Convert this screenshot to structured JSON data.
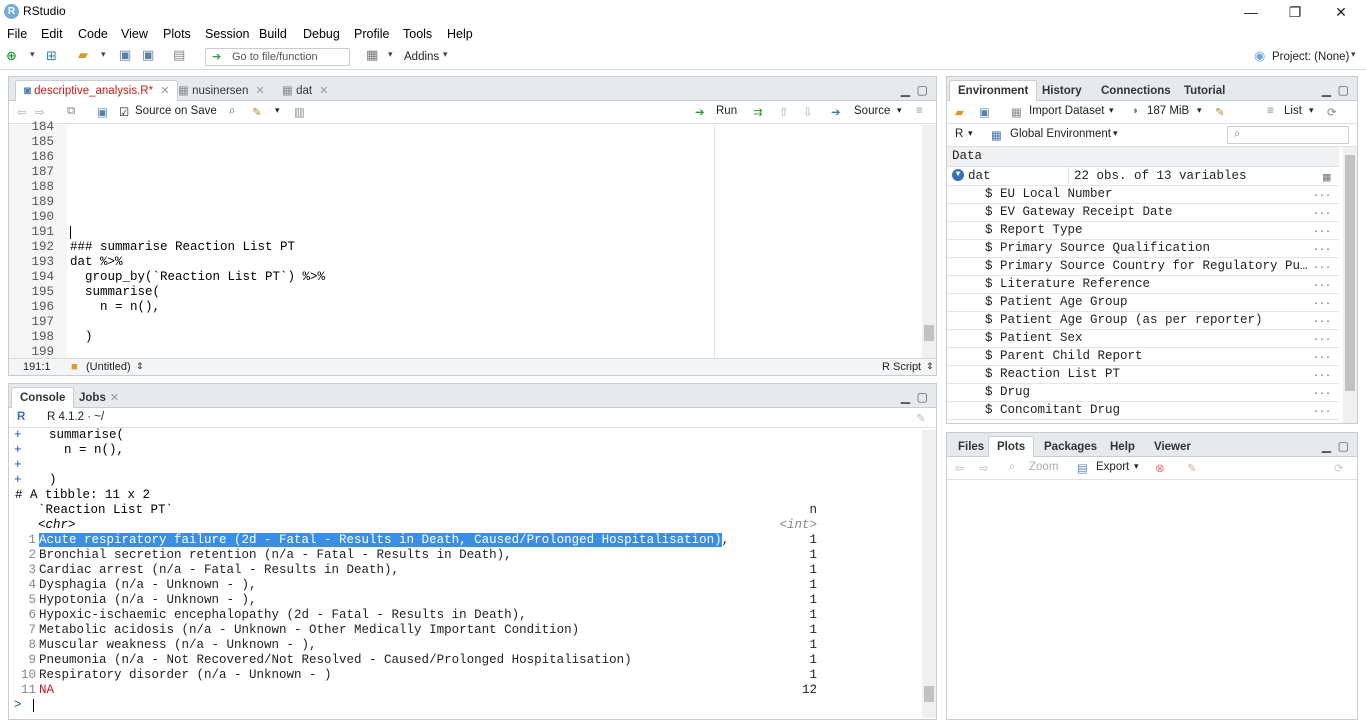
{
  "window": {
    "title": "RStudio",
    "logo_letter": "R",
    "minimize": "—",
    "restore": "❐",
    "close": "✕"
  },
  "menu": [
    "File",
    "Edit",
    "Code",
    "View",
    "Plots",
    "Session",
    "Build",
    "Debug",
    "Profile",
    "Tools",
    "Help"
  ],
  "toolbar": {
    "goto_placeholder": "Go to file/function",
    "addins": "Addins",
    "project": "Project: (None)"
  },
  "editor": {
    "tabs": [
      {
        "label": "descriptive_analysis.R*",
        "active": true
      },
      {
        "label": "nusinersen",
        "active": false
      },
      {
        "label": "dat",
        "active": false
      }
    ],
    "source_on_save": "Source on Save",
    "run": "Run",
    "source": "Source",
    "lines": [
      {
        "n": "184",
        "t": ""
      },
      {
        "n": "185",
        "t": ""
      },
      {
        "n": "186",
        "t": ""
      },
      {
        "n": "187",
        "t": ""
      },
      {
        "n": "188",
        "t": ""
      },
      {
        "n": "189",
        "t": ""
      },
      {
        "n": "190",
        "t": ""
      },
      {
        "n": "191",
        "t": ""
      },
      {
        "n": "192",
        "t": "### summarise Reaction List PT"
      },
      {
        "n": "193",
        "t": "dat %>%"
      },
      {
        "n": "194",
        "t": "  group_by(`Reaction List PT`) %>%"
      },
      {
        "n": "195",
        "t": "  summarise("
      },
      {
        "n": "196",
        "t": "    n = n(),"
      },
      {
        "n": "197",
        "t": ""
      },
      {
        "n": "198",
        "t": "  )"
      },
      {
        "n": "199",
        "t": ""
      }
    ],
    "status_pos": "191:1",
    "status_scope": "(Untitled)",
    "status_type": "R Script"
  },
  "console": {
    "tabs": [
      {
        "label": "Console",
        "active": true
      },
      {
        "label": "Jobs",
        "active": false
      }
    ],
    "r_version": "R 4.1.2 · ~/",
    "cont_lines": [
      {
        "p": "+",
        "t": "  summarise("
      },
      {
        "p": "+",
        "t": "    n = n(),"
      },
      {
        "p": "+",
        "t": ""
      },
      {
        "p": "+",
        "t": "  )"
      }
    ],
    "tibble_header": "# A tibble: 11 x 2",
    "col1": "  `Reaction List PT`",
    "col2": "n",
    "type1": "  <chr>",
    "type2": "<int>",
    "rows": [
      {
        "i": "1",
        "v": "Acute respiratory failure (2d - Fatal - Results in Death, Caused/Prolonged Hospitalisation)",
        "suffix": ",",
        "n": "1"
      },
      {
        "i": "2",
        "v": "Bronchial secretion retention (n/a - Fatal - Results in Death),",
        "suffix": "",
        "n": "1"
      },
      {
        "i": "3",
        "v": "Cardiac arrest (n/a - Fatal - Results in Death),",
        "suffix": "",
        "n": "1"
      },
      {
        "i": "4",
        "v": "Dysphagia (n/a - Unknown - ),",
        "suffix": "",
        "n": "1"
      },
      {
        "i": "5",
        "v": "Hypotonia (n/a - Unknown - ),",
        "suffix": "",
        "n": "1"
      },
      {
        "i": "6",
        "v": "Hypoxic-ischaemic encephalopathy (2d - Fatal - Results in Death),",
        "suffix": "",
        "n": "1"
      },
      {
        "i": "7",
        "v": "Metabolic acidosis (n/a - Unknown - Other Medically Important Condition)",
        "suffix": "",
        "n": "1"
      },
      {
        "i": "8",
        "v": "Muscular weakness (n/a - Unknown - ),",
        "suffix": "",
        "n": "1"
      },
      {
        "i": "9",
        "v": "Pneumonia (n/a - Not Recovered/Not Resolved - Caused/Prolonged Hospitalisation)",
        "suffix": "",
        "n": "1"
      },
      {
        "i": "10",
        "v": "Respiratory disorder (n/a - Unknown - )",
        "suffix": "",
        "n": "1"
      },
      {
        "i": "11",
        "v": "NA",
        "suffix": "",
        "n": "12"
      }
    ],
    "prompt": ">"
  },
  "environment": {
    "tabs": [
      {
        "label": "Environment",
        "active": true
      },
      {
        "label": "History",
        "active": false
      },
      {
        "label": "Connections",
        "active": false
      },
      {
        "label": "Tutorial",
        "active": false
      }
    ],
    "import_dataset": "Import Dataset",
    "memory": "187 MiB",
    "view_mode": "List",
    "lang": "R",
    "scope": "Global Environment",
    "section": "Data",
    "obj_name": "dat",
    "obj_desc": "22 obs. of 13 variables",
    "vars": [
      "$ EU Local Number",
      "$ EV Gateway Receipt Date",
      "$ Report Type",
      "$ Primary Source Qualification",
      "$ Primary Source Country for Regulatory Pu…",
      "$ Literature Reference",
      "$ Patient Age Group",
      "$ Patient Age Group (as per reporter)",
      "$ Patient Sex",
      "$ Parent Child Report",
      "$ Reaction List PT",
      "$ Drug",
      "$ Concomitant Drug"
    ],
    "dots": "..."
  },
  "files": {
    "tabs": [
      {
        "label": "Files",
        "active": false
      },
      {
        "label": "Plots",
        "active": true
      },
      {
        "label": "Packages",
        "active": false
      },
      {
        "label": "Help",
        "active": false
      },
      {
        "label": "Viewer",
        "active": false
      }
    ],
    "zoom": "Zoom",
    "export": "Export"
  }
}
